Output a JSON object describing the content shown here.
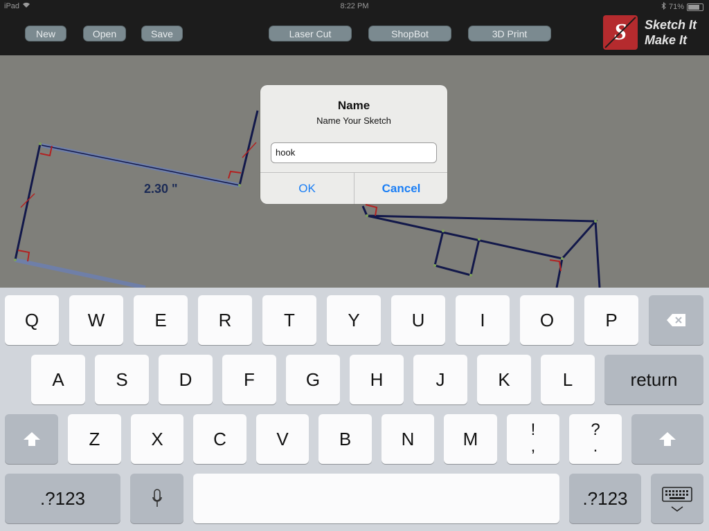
{
  "status_bar": {
    "device": "iPad",
    "time": "8:22 PM",
    "battery": "71%",
    "battery_level": 0.71
  },
  "toolbar": {
    "new_label": "New",
    "open_label": "Open",
    "save_label": "Save",
    "laser_cut_label": "Laser Cut",
    "shopbot_label": "ShopBot",
    "print3d_label": "3D Print",
    "logo_line1": "Sketch It",
    "logo_line2": "Make It"
  },
  "canvas": {
    "dimension_label": "2.30 \""
  },
  "alert": {
    "title": "Name",
    "message": "Name Your Sketch",
    "input_value": "hook",
    "ok_label": "OK",
    "cancel_label": "Cancel"
  },
  "keyboard": {
    "row1": [
      "Q",
      "W",
      "E",
      "R",
      "T",
      "Y",
      "U",
      "I",
      "O",
      "P"
    ],
    "row2": [
      "A",
      "S",
      "D",
      "F",
      "G",
      "H",
      "J",
      "K",
      "L"
    ],
    "row3": [
      "Z",
      "X",
      "C",
      "V",
      "B",
      "N",
      "M"
    ],
    "return_label": "return",
    "exclaim_top": "!",
    "exclaim_bottom": ",",
    "question_top": "?",
    "question_bottom": ".",
    "numbers_left": ".?123",
    "numbers_right": ".?123"
  },
  "colors": {
    "link_blue": "#1a7ef5",
    "logo_red": "#b52b2e",
    "sketch_line": "#12184a",
    "selected_line": "#6f7fa8",
    "angle_mark": "#b32020"
  }
}
